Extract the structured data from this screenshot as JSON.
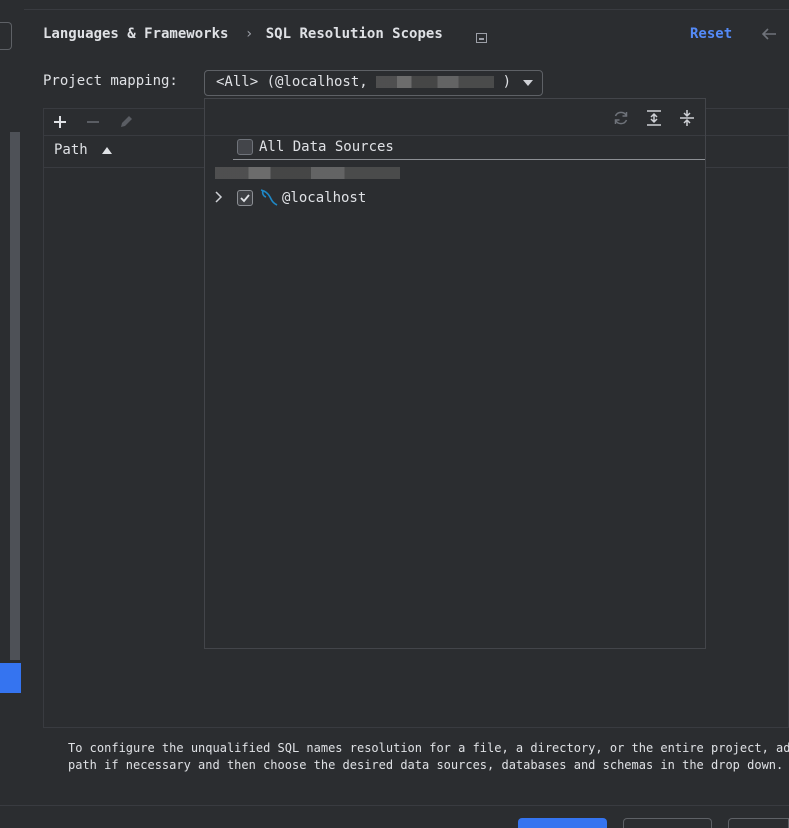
{
  "breadcrumb": {
    "parent": "Languages & Frameworks",
    "separator": "›",
    "current": "SQL Resolution Scopes"
  },
  "header": {
    "reset_label": "Reset",
    "back_icon": "arrow-left-icon"
  },
  "mapping": {
    "label": "Project mapping:",
    "selected_value": "<All> (@localhost,",
    "selected_suffix": ")"
  },
  "toolbar": {
    "add_icon": "plus-icon",
    "remove_icon": "minus-icon",
    "edit_icon": "pencil-icon"
  },
  "table": {
    "columns": [
      {
        "label": "Path",
        "sort": "ascending"
      }
    ]
  },
  "popup": {
    "toolbar_icons": [
      "refresh-icon",
      "expand-all-icon",
      "collapse-all-icon"
    ],
    "all_sources_label": "All Data Sources",
    "all_sources_checked": false,
    "items": [
      {
        "label": "@localhost",
        "checked": true,
        "expandable": true,
        "icon": "mysql-dolphin-icon"
      }
    ]
  },
  "info_text": "To configure the unqualified SQL names resolution for a file, a directory, or the entire project, add its\npath if necessary and then choose the desired data sources, databases and schemas in the drop down.",
  "colors": {
    "background": "#2b2d30",
    "accent": "#548af7",
    "selection": "#3574f0",
    "mysql_icon": "#1e88c7"
  }
}
